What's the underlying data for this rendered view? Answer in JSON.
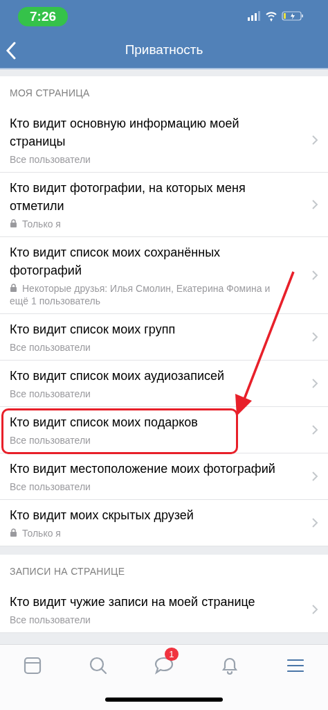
{
  "status_bar": {
    "time": "7:26"
  },
  "nav_bar": {
    "title": "Приватность"
  },
  "sections": [
    {
      "header": "МОЯ СТРАНИЦА",
      "items": [
        {
          "title": "Кто видит основную информацию моей страницы",
          "value": "Все пользователи",
          "lock": false,
          "highlighted": false
        },
        {
          "title": "Кто видит фотографии, на которых меня отметили",
          "value": "Только я",
          "lock": true,
          "highlighted": false
        },
        {
          "title": "Кто видит список моих сохранённых фотографий",
          "value": "Некоторые друзья: Илья Смолин, Екатерина Фомина и ещё 1 пользователь",
          "lock": true,
          "highlighted": false
        },
        {
          "title": "Кто видит список моих групп",
          "value": "Все пользователи",
          "lock": false,
          "highlighted": false
        },
        {
          "title": "Кто видит список моих аудиозаписей",
          "value": "Все пользователи",
          "lock": false,
          "highlighted": false
        },
        {
          "title": "Кто видит список моих подарков",
          "value": "Все пользователи",
          "lock": false,
          "highlighted": true
        },
        {
          "title": "Кто видит местоположение моих фотографий",
          "value": "Все пользователи",
          "lock": false,
          "highlighted": false
        },
        {
          "title": "Кто видит моих скрытых друзей",
          "value": "Только я",
          "lock": true,
          "highlighted": false
        }
      ]
    },
    {
      "header": "ЗАПИСИ НА СТРАНИЦЕ",
      "items": [
        {
          "title": "Кто видит чужие записи на моей странице",
          "value": "Все пользователи",
          "lock": false,
          "highlighted": false
        }
      ]
    }
  ],
  "tab_bar": [
    {
      "kind": "news",
      "selected": false
    },
    {
      "kind": "search",
      "selected": false
    },
    {
      "kind": "messages",
      "selected": false,
      "badge": "1"
    },
    {
      "kind": "notifications",
      "selected": false
    },
    {
      "kind": "menu",
      "selected": true
    }
  ]
}
